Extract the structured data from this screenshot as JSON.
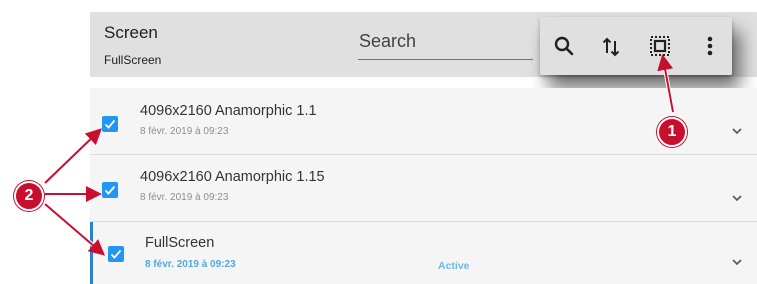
{
  "header": {
    "title": "Screen",
    "subtitle": "FullScreen",
    "search_placeholder": "Search"
  },
  "toolbar": {
    "buttons": [
      {
        "icon": "search-icon"
      },
      {
        "icon": "sort-icon"
      },
      {
        "icon": "select-all-icon"
      },
      {
        "icon": "more-vert-icon"
      }
    ]
  },
  "rows": [
    {
      "title": "4096x2160 Anamorphic 1.1",
      "date": "8 févr. 2019 à 09:23",
      "status": "",
      "checked": true,
      "active": false
    },
    {
      "title": "4096x2160 Anamorphic 1.15",
      "date": "8 févr. 2019 à 09:23",
      "status": "",
      "checked": true,
      "active": false
    },
    {
      "title": "FullScreen",
      "date": "8 févr. 2019 à 09:23",
      "status": "Active",
      "checked": true,
      "active": true
    }
  ],
  "callouts": {
    "one": "1",
    "two": "2"
  },
  "colors": {
    "checkbox": "#2196f3",
    "callout": "#c8102e",
    "active_accent": "#2f7fd0",
    "header_bg": "#e0e0e0",
    "list_bg": "#f5f5f5"
  }
}
